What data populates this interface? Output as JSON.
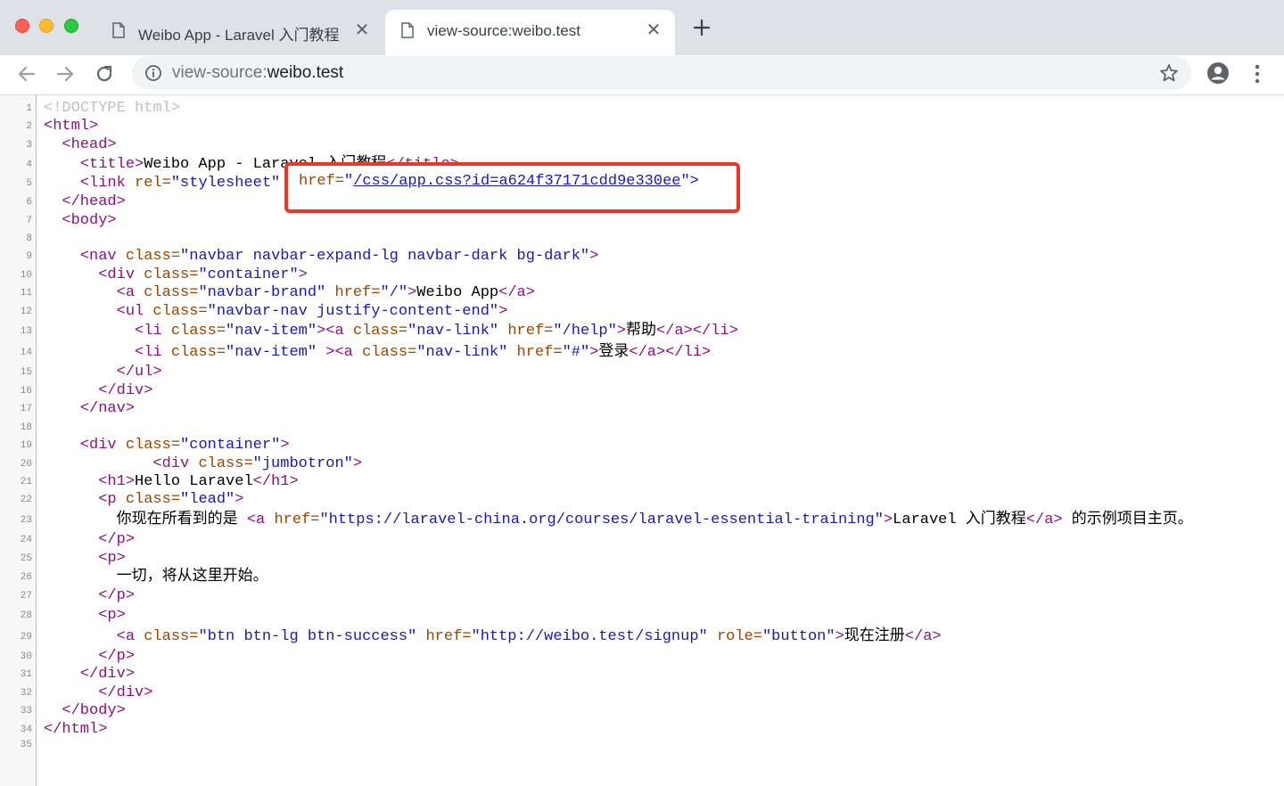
{
  "tabs": [
    {
      "title": "Weibo App - Laravel 入门教程",
      "active": false
    },
    {
      "title": "view-source:weibo.test",
      "active": true
    }
  ],
  "omnibox": {
    "scheme": "view-source:",
    "host": "weibo.test"
  },
  "source_lines": [
    {
      "n": "1",
      "parts": [
        [
          "doctype",
          "<!DOCTYPE html>"
        ]
      ]
    },
    {
      "n": "2",
      "parts": [
        [
          "tag",
          "<html>"
        ]
      ]
    },
    {
      "n": "3",
      "parts": [
        [
          "tag",
          "  <head>"
        ]
      ]
    },
    {
      "n": "4",
      "parts": [
        [
          "tag",
          "    <title>"
        ],
        [
          "text",
          "Weibo App - Laravel 入门教程"
        ],
        [
          "tag",
          "</title>"
        ]
      ]
    },
    {
      "n": "5",
      "parts": [
        [
          "tag",
          "    <link "
        ],
        [
          "attr",
          "rel="
        ],
        [
          "val",
          "\"stylesheet\""
        ]
      ]
    },
    {
      "n": "6",
      "parts": [
        [
          "tag",
          "  </head>"
        ]
      ]
    },
    {
      "n": "7",
      "parts": [
        [
          "tag",
          "  <body>"
        ]
      ]
    },
    {
      "n": "8",
      "parts": []
    },
    {
      "n": "9",
      "parts": [
        [
          "tag",
          "    <nav "
        ],
        [
          "attr",
          "class="
        ],
        [
          "val",
          "\"navbar navbar-expand-lg navbar-dark bg-dark\""
        ],
        [
          "tag",
          ">"
        ]
      ]
    },
    {
      "n": "10",
      "parts": [
        [
          "tag",
          "      <div "
        ],
        [
          "attr",
          "class="
        ],
        [
          "val",
          "\"container\""
        ],
        [
          "tag",
          ">"
        ]
      ]
    },
    {
      "n": "11",
      "parts": [
        [
          "tag",
          "        <a "
        ],
        [
          "attr",
          "class="
        ],
        [
          "val",
          "\"navbar-brand\""
        ],
        [
          "attr",
          " href="
        ],
        [
          "val",
          "\"/\""
        ],
        [
          "tag",
          ">"
        ],
        [
          "text",
          "Weibo App"
        ],
        [
          "tag",
          "</a>"
        ]
      ]
    },
    {
      "n": "12",
      "parts": [
        [
          "tag",
          "        <ul "
        ],
        [
          "attr",
          "class="
        ],
        [
          "val",
          "\"navbar-nav justify-content-end\""
        ],
        [
          "tag",
          ">"
        ]
      ]
    },
    {
      "n": "13",
      "parts": [
        [
          "tag",
          "          <li "
        ],
        [
          "attr",
          "class="
        ],
        [
          "val",
          "\"nav-item\""
        ],
        [
          "tag",
          "><a "
        ],
        [
          "attr",
          "class="
        ],
        [
          "val",
          "\"nav-link\""
        ],
        [
          "attr",
          " href="
        ],
        [
          "val",
          "\"/help\""
        ],
        [
          "tag",
          ">"
        ],
        [
          "text",
          "帮助"
        ],
        [
          "tag",
          "</a></li>"
        ]
      ]
    },
    {
      "n": "14",
      "parts": [
        [
          "tag",
          "          <li "
        ],
        [
          "attr",
          "class="
        ],
        [
          "val",
          "\"nav-item\""
        ],
        [
          "tag",
          " ><a "
        ],
        [
          "attr",
          "class="
        ],
        [
          "val",
          "\"nav-link\""
        ],
        [
          "attr",
          " href="
        ],
        [
          "val",
          "\"#\""
        ],
        [
          "tag",
          ">"
        ],
        [
          "text",
          "登录"
        ],
        [
          "tag",
          "</a></li>"
        ]
      ]
    },
    {
      "n": "15",
      "parts": [
        [
          "tag",
          "        </ul>"
        ]
      ]
    },
    {
      "n": "16",
      "parts": [
        [
          "tag",
          "      </div>"
        ]
      ]
    },
    {
      "n": "17",
      "parts": [
        [
          "tag",
          "    </nav>"
        ]
      ]
    },
    {
      "n": "18",
      "parts": []
    },
    {
      "n": "19",
      "parts": [
        [
          "tag",
          "    <div "
        ],
        [
          "attr",
          "class="
        ],
        [
          "val",
          "\"container\""
        ],
        [
          "tag",
          ">"
        ]
      ]
    },
    {
      "n": "20",
      "parts": [
        [
          "tag",
          "            <div "
        ],
        [
          "attr",
          "class="
        ],
        [
          "val",
          "\"jumbotron\""
        ],
        [
          "tag",
          ">"
        ]
      ]
    },
    {
      "n": "21",
      "parts": [
        [
          "tag",
          "      <h1>"
        ],
        [
          "text",
          "Hello Laravel"
        ],
        [
          "tag",
          "</h1>"
        ]
      ]
    },
    {
      "n": "22",
      "parts": [
        [
          "tag",
          "      <p "
        ],
        [
          "attr",
          "class="
        ],
        [
          "val",
          "\"lead\""
        ],
        [
          "tag",
          ">"
        ]
      ]
    },
    {
      "n": "23",
      "parts": [
        [
          "text",
          "        你现在所看到的是 "
        ],
        [
          "tag",
          "<a "
        ],
        [
          "attr",
          "href="
        ],
        [
          "val",
          "\"https://laravel-china.org/courses/laravel-essential-training\""
        ],
        [
          "tag",
          ">"
        ],
        [
          "text",
          "Laravel 入门教程"
        ],
        [
          "tag",
          "</a>"
        ],
        [
          "text",
          " 的示例项目主页。"
        ]
      ]
    },
    {
      "n": "24",
      "parts": [
        [
          "tag",
          "      </p>"
        ]
      ]
    },
    {
      "n": "25",
      "parts": [
        [
          "tag",
          "      <p>"
        ]
      ]
    },
    {
      "n": "26",
      "parts": [
        [
          "text",
          "        一切，将从这里开始。"
        ]
      ]
    },
    {
      "n": "27",
      "parts": [
        [
          "tag",
          "      </p>"
        ]
      ]
    },
    {
      "n": "28",
      "parts": [
        [
          "tag",
          "      <p>"
        ]
      ]
    },
    {
      "n": "29",
      "parts": [
        [
          "tag",
          "        <a "
        ],
        [
          "attr",
          "class="
        ],
        [
          "val",
          "\"btn btn-lg btn-success\""
        ],
        [
          "attr",
          " href="
        ],
        [
          "val",
          "\"http://weibo.test/signup\""
        ],
        [
          "attr",
          " role="
        ],
        [
          "val",
          "\"button\""
        ],
        [
          "tag",
          ">"
        ],
        [
          "text",
          "现在注册"
        ],
        [
          "tag",
          "</a>"
        ]
      ]
    },
    {
      "n": "30",
      "parts": [
        [
          "tag",
          "      </p>"
        ]
      ]
    },
    {
      "n": "31",
      "parts": [
        [
          "tag",
          "    </div>"
        ]
      ]
    },
    {
      "n": "32",
      "parts": [
        [
          "tag",
          "      </div>"
        ]
      ]
    },
    {
      "n": "33",
      "parts": [
        [
          "tag",
          "  </body>"
        ]
      ]
    },
    {
      "n": "34",
      "parts": [
        [
          "tag",
          "</html>"
        ]
      ]
    },
    {
      "n": "35",
      "parts": []
    }
  ],
  "highlight": {
    "attr": "href=",
    "quote_open": "\"",
    "link": "/css/app.css?id=a624f37171cdd9e330ee",
    "tail": "\">"
  },
  "colors": {
    "highlight_border": "#e8382c",
    "tag": "#881280",
    "attr": "#994500",
    "value": "#1a1aa6"
  }
}
